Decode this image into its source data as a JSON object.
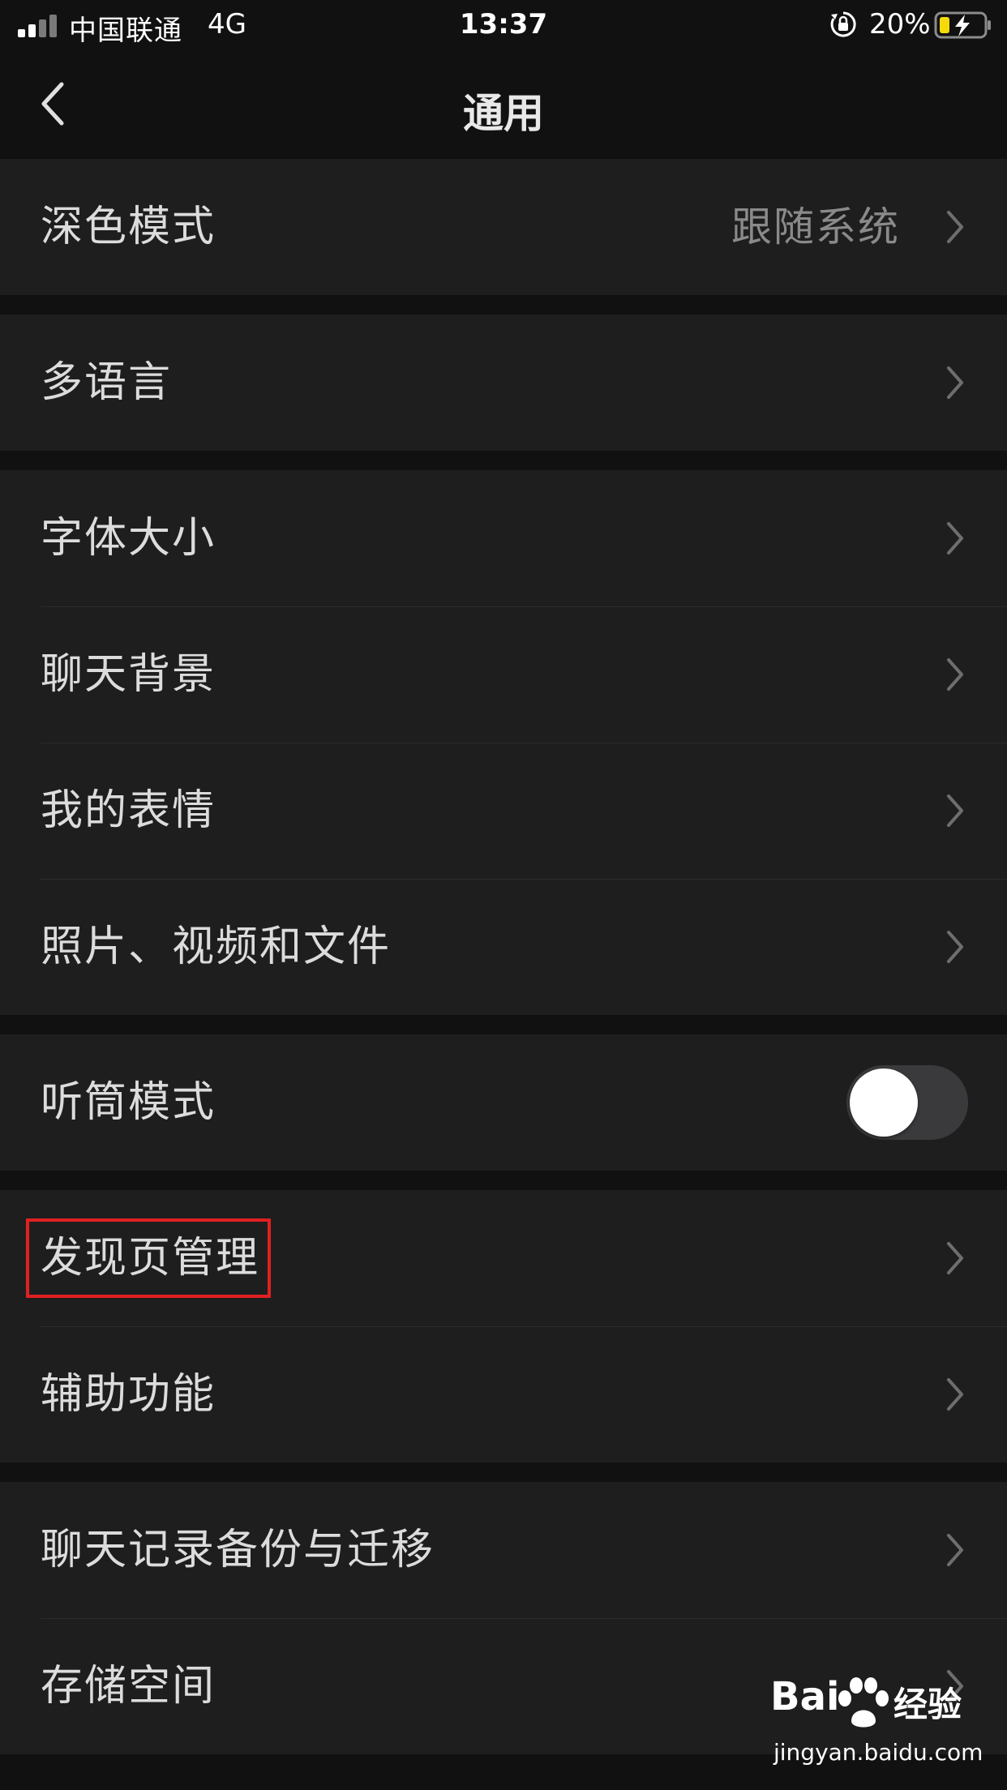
{
  "status_bar": {
    "carrier": "中国联通",
    "network": "4G",
    "time": "13:37",
    "battery_percent": "20%"
  },
  "nav": {
    "title": "通用"
  },
  "settings": {
    "dark_mode": {
      "label": "深色模式",
      "value": "跟随系统"
    },
    "language": {
      "label": "多语言"
    },
    "font_size": {
      "label": "字体大小"
    },
    "chat_background": {
      "label": "聊天背景"
    },
    "my_stickers": {
      "label": "我的表情"
    },
    "media_files": {
      "label": "照片、视频和文件"
    },
    "earpiece_mode": {
      "label": "听筒模式",
      "enabled": false
    },
    "discover_management": {
      "label": "发现页管理"
    },
    "accessibility": {
      "label": "辅助功能"
    },
    "chat_backup": {
      "label": "聊天记录备份与迁移"
    },
    "storage": {
      "label": "存储空间"
    }
  },
  "watermark": {
    "logo_latin": "Bai",
    "logo_cn": "经验",
    "url": "jingyan.baidu.com"
  },
  "colors": {
    "background": "#111111",
    "cell": "#1e1e1e",
    "text": "#dcdcdc",
    "secondary_text": "#8a8a8a",
    "highlight": "#e02020",
    "toggle_off": "#3a3a3c",
    "battery": "#f5d90a"
  }
}
